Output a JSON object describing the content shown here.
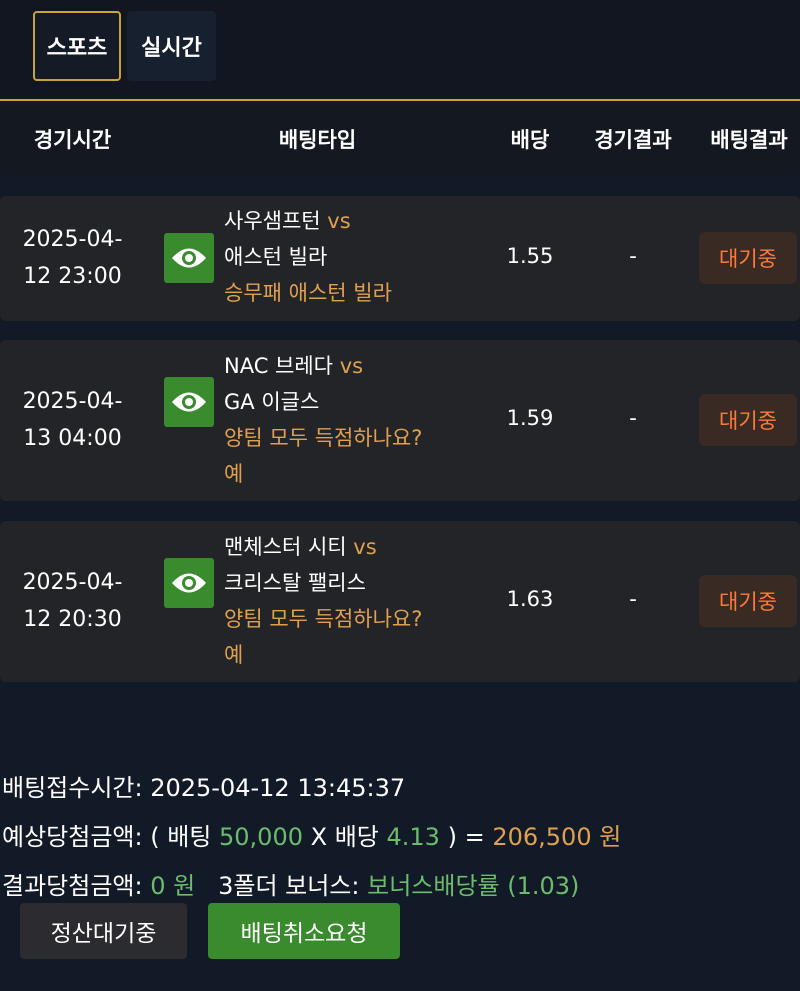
{
  "tabs": [
    {
      "label": "스포츠",
      "active": true
    },
    {
      "label": "실시간",
      "active": false
    }
  ],
  "columns": {
    "time": "경기시간",
    "type": "배팅타입",
    "odds": "배당",
    "game_result": "경기결과",
    "bet_result": "배팅결과"
  },
  "bets": [
    {
      "time_line1": "2025-04-",
      "time_line2": "12 23:00",
      "home": "사우샘프턴",
      "vs": "vs",
      "away": "애스턴 빌라",
      "pick_line1": "승무패 애스턴 빌라",
      "pick_line2": "",
      "odds": "1.55",
      "result": "-",
      "status": "대기중"
    },
    {
      "time_line1": "2025-04-",
      "time_line2": "13 04:00",
      "home": "NAC 브레다",
      "vs": "vs",
      "away": "GA 이글스",
      "pick_line1": "양팀 모두 득점하나요?",
      "pick_line2": "예",
      "odds": "1.59",
      "result": "-",
      "status": "대기중"
    },
    {
      "time_line1": "2025-04-",
      "time_line2": "12 20:30",
      "home": "맨체스터 시티",
      "vs": "vs",
      "away": "크리스탈 팰리스",
      "pick_line1": "양팀 모두 득점하나요?",
      "pick_line2": "예",
      "odds": "1.63",
      "result": "-",
      "status": "대기중"
    }
  ],
  "summary": {
    "received_label": "배팅접수시간:",
    "received_value": "2025-04-12 13:45:37",
    "expected_label": "예상당첨금액:",
    "open_paren": "( 배팅",
    "stake": "50,000",
    "times": "X 배당",
    "total_odds": "4.13",
    "close_eq": ") =",
    "expected_amount": "206,500 원",
    "result_label": "결과당첨금액:",
    "result_amount": "0 원",
    "bonus_label": "3폴더 보너스:",
    "bonus_value": "보너스배당률 (1.03)"
  },
  "buttons": {
    "settle": "정산대기중",
    "cancel": "배팅취소요청"
  },
  "colors": {
    "accent_gold": "#c8a23a",
    "orange_text": "#e0a050",
    "green": "#3a8a2e",
    "status_orange": "#ff7a3a"
  },
  "icons": {
    "view": "eye-icon"
  }
}
